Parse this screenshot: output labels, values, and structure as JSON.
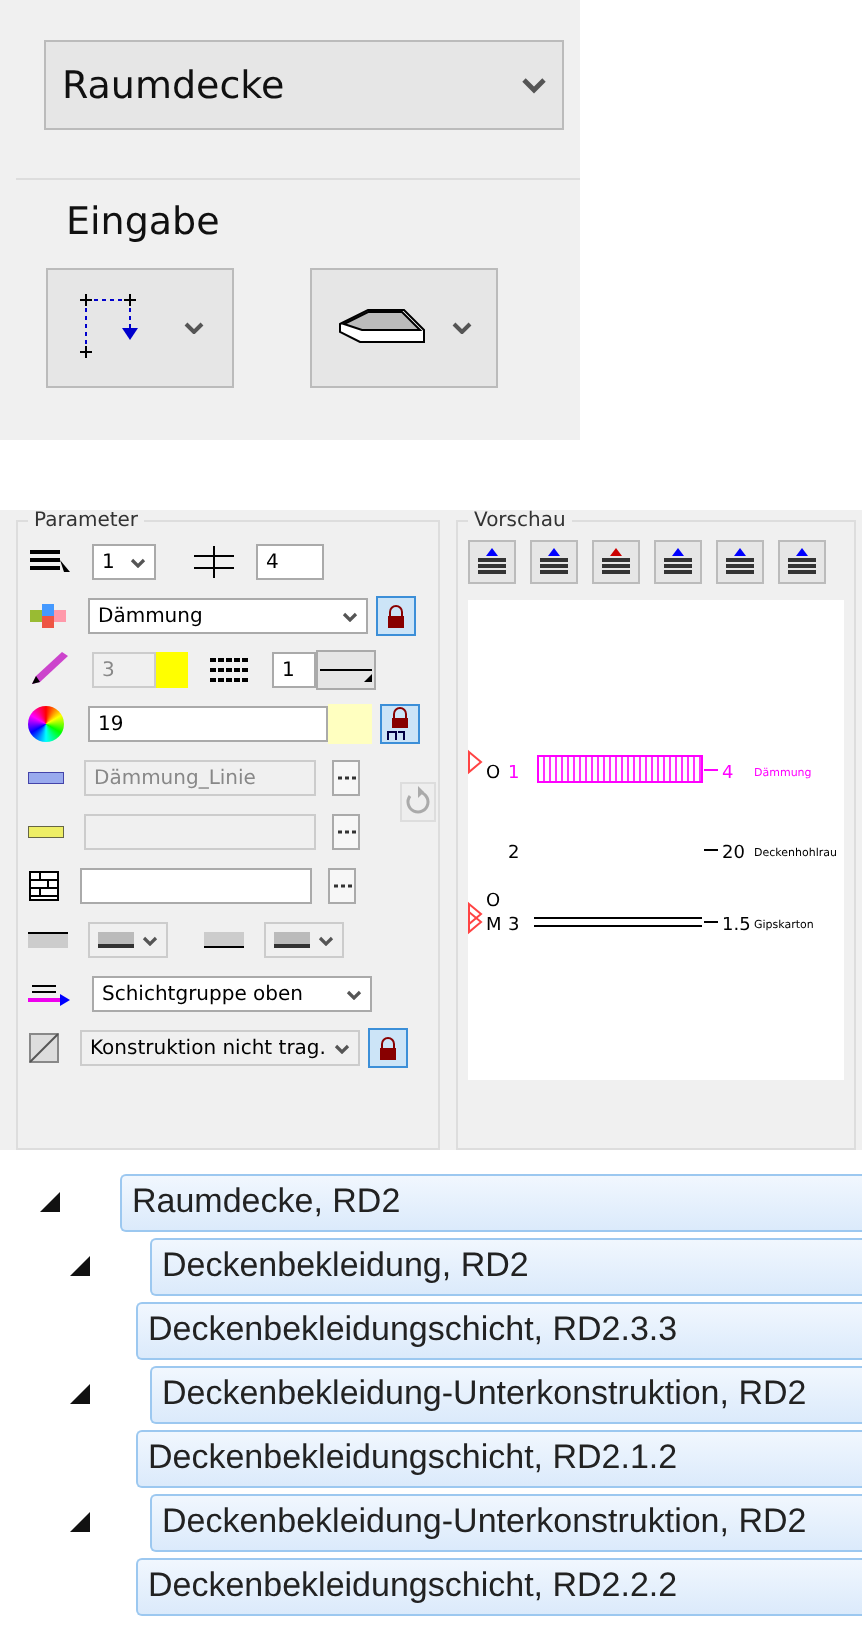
{
  "element_type": {
    "value": "Raumdecke"
  },
  "input": {
    "title": "Eingabe",
    "tools": [
      {
        "kind": "polygon"
      },
      {
        "kind": "slab"
      }
    ]
  },
  "parameter": {
    "title": "Parameter",
    "layer": "1",
    "thickness": "4",
    "material": {
      "value": "Dämmung",
      "locked": true
    },
    "pen": {
      "value": "3",
      "color": "#ffff00",
      "disabled": true
    },
    "line": "1",
    "fill": {
      "value": "19",
      "color": "#ffffc0",
      "locked": true
    },
    "line_style": {
      "value": "Dämmung_Linie",
      "disabled": true
    },
    "pattern": {
      "disabled": true
    },
    "surface": {
      "disabled": false
    },
    "hatch": {
      "disabled": true
    },
    "layer_group": "Schichtgruppe oben",
    "construction": {
      "value": "Konstruktion nicht trag.",
      "locked": true
    }
  },
  "preview": {
    "title": "Vorschau",
    "layers": [
      {
        "number": "1",
        "thickness": "4",
        "name": "Dämmung",
        "kind": "insulation",
        "color": "#ff00ff",
        "references": [
          "O"
        ]
      },
      {
        "number": "2",
        "thickness": "20",
        "name": "Deckenhohlrau",
        "kind": "void",
        "color": "#000000"
      },
      {
        "number": "3",
        "thickness": "1.5",
        "name": "Gipskarton",
        "kind": "board",
        "color": "#000000",
        "references": [
          "O",
          "M"
        ]
      }
    ]
  },
  "tree": [
    {
      "label": "Raumdecke, RD2",
      "selected": true,
      "expanded": true,
      "children": [
        {
          "label": "Deckenbekleidung, RD2",
          "selected": true,
          "expanded": true,
          "children": [
            {
              "label": "Deckenbekleidungschicht, RD2.3.3",
              "selected": true
            }
          ]
        },
        {
          "label": "Deckenbekleidung-Unterkonstruktion, RD2",
          "selected": true,
          "expanded": true,
          "children": [
            {
              "label": "Deckenbekleidungschicht, RD2.1.2",
              "selected": true
            }
          ]
        },
        {
          "label": "Deckenbekleidung-Unterkonstruktion, RD2",
          "selected": true,
          "expanded": true,
          "children": [
            {
              "label": "Deckenbekleidungschicht, RD2.2.2",
              "selected": true
            }
          ]
        }
      ]
    }
  ]
}
